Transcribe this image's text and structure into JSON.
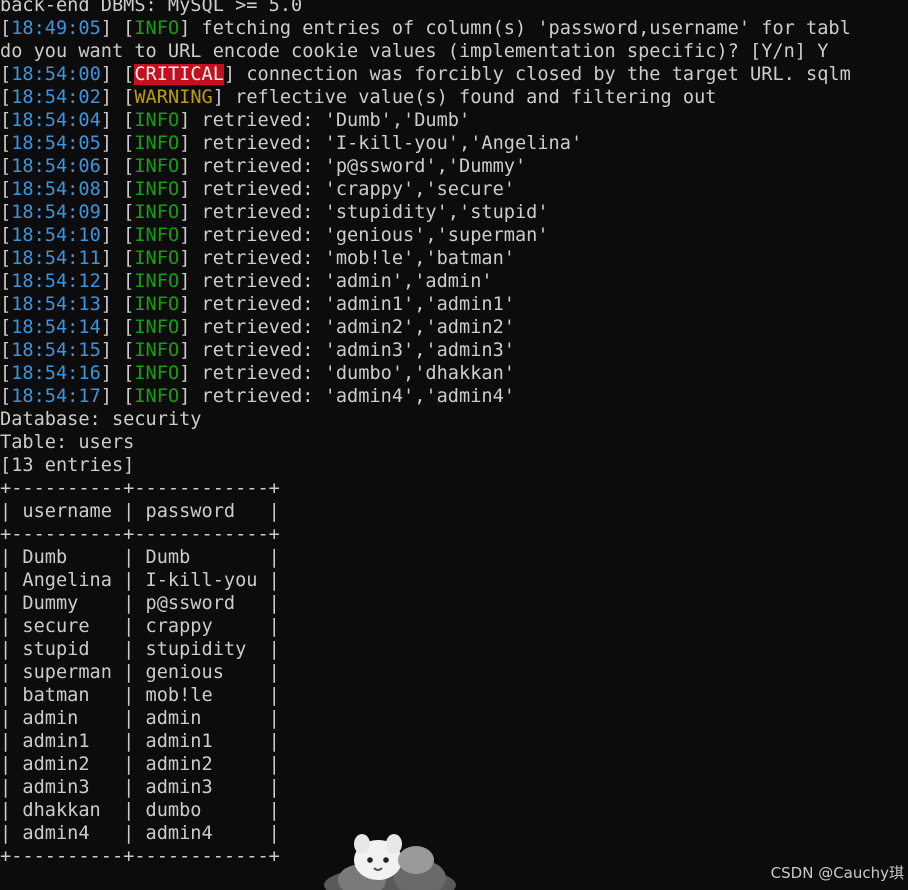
{
  "terminal": {
    "lines": [
      {
        "type": "plain",
        "text": "back-end DBMS: MySQL >= 5.0"
      },
      {
        "type": "log",
        "time": "18:49:05",
        "level": "INFO",
        "message": "fetching entries of column(s) 'password,username' for tabl"
      },
      {
        "type": "plain",
        "text": "do you want to URL encode cookie values (implementation specific)? [Y/n] Y"
      },
      {
        "type": "log",
        "time": "18:54:00",
        "level": "CRITICAL",
        "message": "connection was forcibly closed by the target URL. sqlm"
      },
      {
        "type": "log",
        "time": "18:54:02",
        "level": "WARNING",
        "message": "reflective value(s) found and filtering out"
      },
      {
        "type": "log",
        "time": "18:54:04",
        "level": "INFO",
        "message": "retrieved: 'Dumb','Dumb'"
      },
      {
        "type": "log",
        "time": "18:54:05",
        "level": "INFO",
        "message": "retrieved: 'I-kill-you','Angelina'"
      },
      {
        "type": "log",
        "time": "18:54:06",
        "level": "INFO",
        "message": "retrieved: 'p@ssword','Dummy'"
      },
      {
        "type": "log",
        "time": "18:54:08",
        "level": "INFO",
        "message": "retrieved: 'crappy','secure'"
      },
      {
        "type": "log",
        "time": "18:54:09",
        "level": "INFO",
        "message": "retrieved: 'stupidity','stupid'"
      },
      {
        "type": "log",
        "time": "18:54:10",
        "level": "INFO",
        "message": "retrieved: 'genious','superman'"
      },
      {
        "type": "log",
        "time": "18:54:11",
        "level": "INFO",
        "message": "retrieved: 'mob!le','batman'"
      },
      {
        "type": "log",
        "time": "18:54:12",
        "level": "INFO",
        "message": "retrieved: 'admin','admin'"
      },
      {
        "type": "log",
        "time": "18:54:13",
        "level": "INFO",
        "message": "retrieved: 'admin1','admin1'"
      },
      {
        "type": "log",
        "time": "18:54:14",
        "level": "INFO",
        "message": "retrieved: 'admin2','admin2'"
      },
      {
        "type": "log",
        "time": "18:54:15",
        "level": "INFO",
        "message": "retrieved: 'admin3','admin3'"
      },
      {
        "type": "log",
        "time": "18:54:16",
        "level": "INFO",
        "message": "retrieved: 'dumbo','dhakkan'"
      },
      {
        "type": "log",
        "time": "18:54:17",
        "level": "INFO",
        "message": "retrieved: 'admin4','admin4'"
      },
      {
        "type": "plain",
        "text": "Database: security"
      },
      {
        "type": "plain",
        "text": "Table: users"
      },
      {
        "type": "plain",
        "text": "[13 entries]"
      }
    ],
    "table": {
      "border": "+----------+------------+",
      "headers": [
        "username",
        "password"
      ],
      "rows": [
        [
          "Dumb",
          "Dumb"
        ],
        [
          "Angelina",
          "I-kill-you"
        ],
        [
          "Dummy",
          "p@ssword"
        ],
        [
          "secure",
          "crappy"
        ],
        [
          "stupid",
          "stupidity"
        ],
        [
          "superman",
          "genious"
        ],
        [
          "batman",
          "mob!le"
        ],
        [
          "admin",
          "admin"
        ],
        [
          "admin1",
          "admin1"
        ],
        [
          "admin2",
          "admin2"
        ],
        [
          "admin3",
          "admin3"
        ],
        [
          "dhakkan",
          "dumbo"
        ],
        [
          "admin4",
          "admin4"
        ]
      ]
    }
  },
  "watermark": "CSDN @Cauchy琪",
  "colors": {
    "background": "#0c0c0c",
    "text": "#cccccc",
    "timestamp": "#3a96dd",
    "info": "#13a10e",
    "warning": "#c19c00",
    "critical_bg": "#c50f1f"
  },
  "decorations": {
    "mascot": "cartoon-mascot-icon"
  }
}
